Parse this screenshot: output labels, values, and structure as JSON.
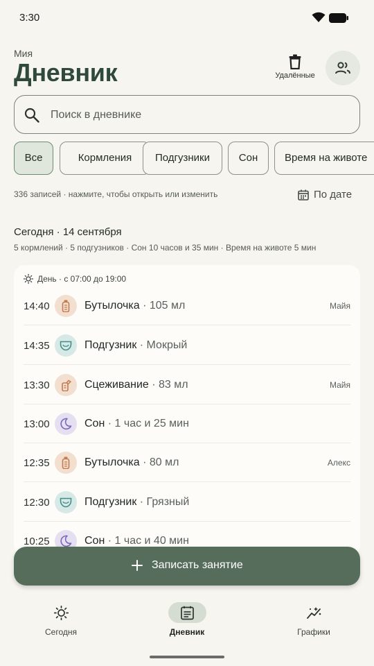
{
  "status_bar": {
    "time": "3:30"
  },
  "header": {
    "profile_name": "Мия",
    "title": "Дневник",
    "deleted_label": "Удалённые"
  },
  "search": {
    "placeholder": "Поиск в дневнике"
  },
  "filters": [
    {
      "label": "Все",
      "active": true
    },
    {
      "label": "Кормления",
      "active": false
    },
    {
      "label": "Подгузники",
      "active": false
    },
    {
      "label": "Сон",
      "active": false
    },
    {
      "label": "Время на животе",
      "active": false
    }
  ],
  "summary": {
    "record_count": "336 записей · нажмите, чтобы открыть или изменить",
    "sort_label": "По дате"
  },
  "day": {
    "title": "Сегодня · 14 сентября",
    "summary": "5 кормлений · 5 подгузников · Сон 10 часов и 35 мин · Время на животе 5 мин",
    "period_label": "День · с 07:00 до 19:00",
    "entries": [
      {
        "time": "14:40",
        "kind": "bottle",
        "name": "Бутылочка",
        "sep": " · ",
        "detail": "105 мл",
        "author": "Майя"
      },
      {
        "time": "14:35",
        "kind": "diaper",
        "name": "Подгузник",
        "sep": " · ",
        "detail": "Мокрый",
        "author": ""
      },
      {
        "time": "13:30",
        "kind": "pump",
        "name": "Сцеживание",
        "sep": " · ",
        "detail": "83 мл",
        "author": "Майя"
      },
      {
        "time": "13:00",
        "kind": "sleep",
        "name": "Сон",
        "sep": " · ",
        "detail": "1 час и 25 мин",
        "author": ""
      },
      {
        "time": "12:35",
        "kind": "bottle",
        "name": "Бутылочка",
        "sep": " · ",
        "detail": "80 мл",
        "author": "Алекс"
      },
      {
        "time": "12:30",
        "kind": "diaper",
        "name": "Подгузник",
        "sep": " · ",
        "detail": "Грязный",
        "author": ""
      },
      {
        "time": "10:25",
        "kind": "sleep",
        "name": "Сон",
        "sep": " · ",
        "detail": "1 час и 40 мин",
        "author": ""
      }
    ]
  },
  "fab": {
    "label": "Записать занятие"
  },
  "nav": [
    {
      "label": "Сегодня",
      "icon": "sun-icon",
      "active": false
    },
    {
      "label": "Дневник",
      "icon": "journal-icon",
      "active": true
    },
    {
      "label": "Графики",
      "icon": "chart-icon",
      "active": false
    }
  ],
  "colors": {
    "accent": "#566d5b",
    "title": "#2f4a3c",
    "bottle_icon": "#c47a4b",
    "diaper_icon": "#3f8f88",
    "sleep_icon": "#7a68b8"
  }
}
